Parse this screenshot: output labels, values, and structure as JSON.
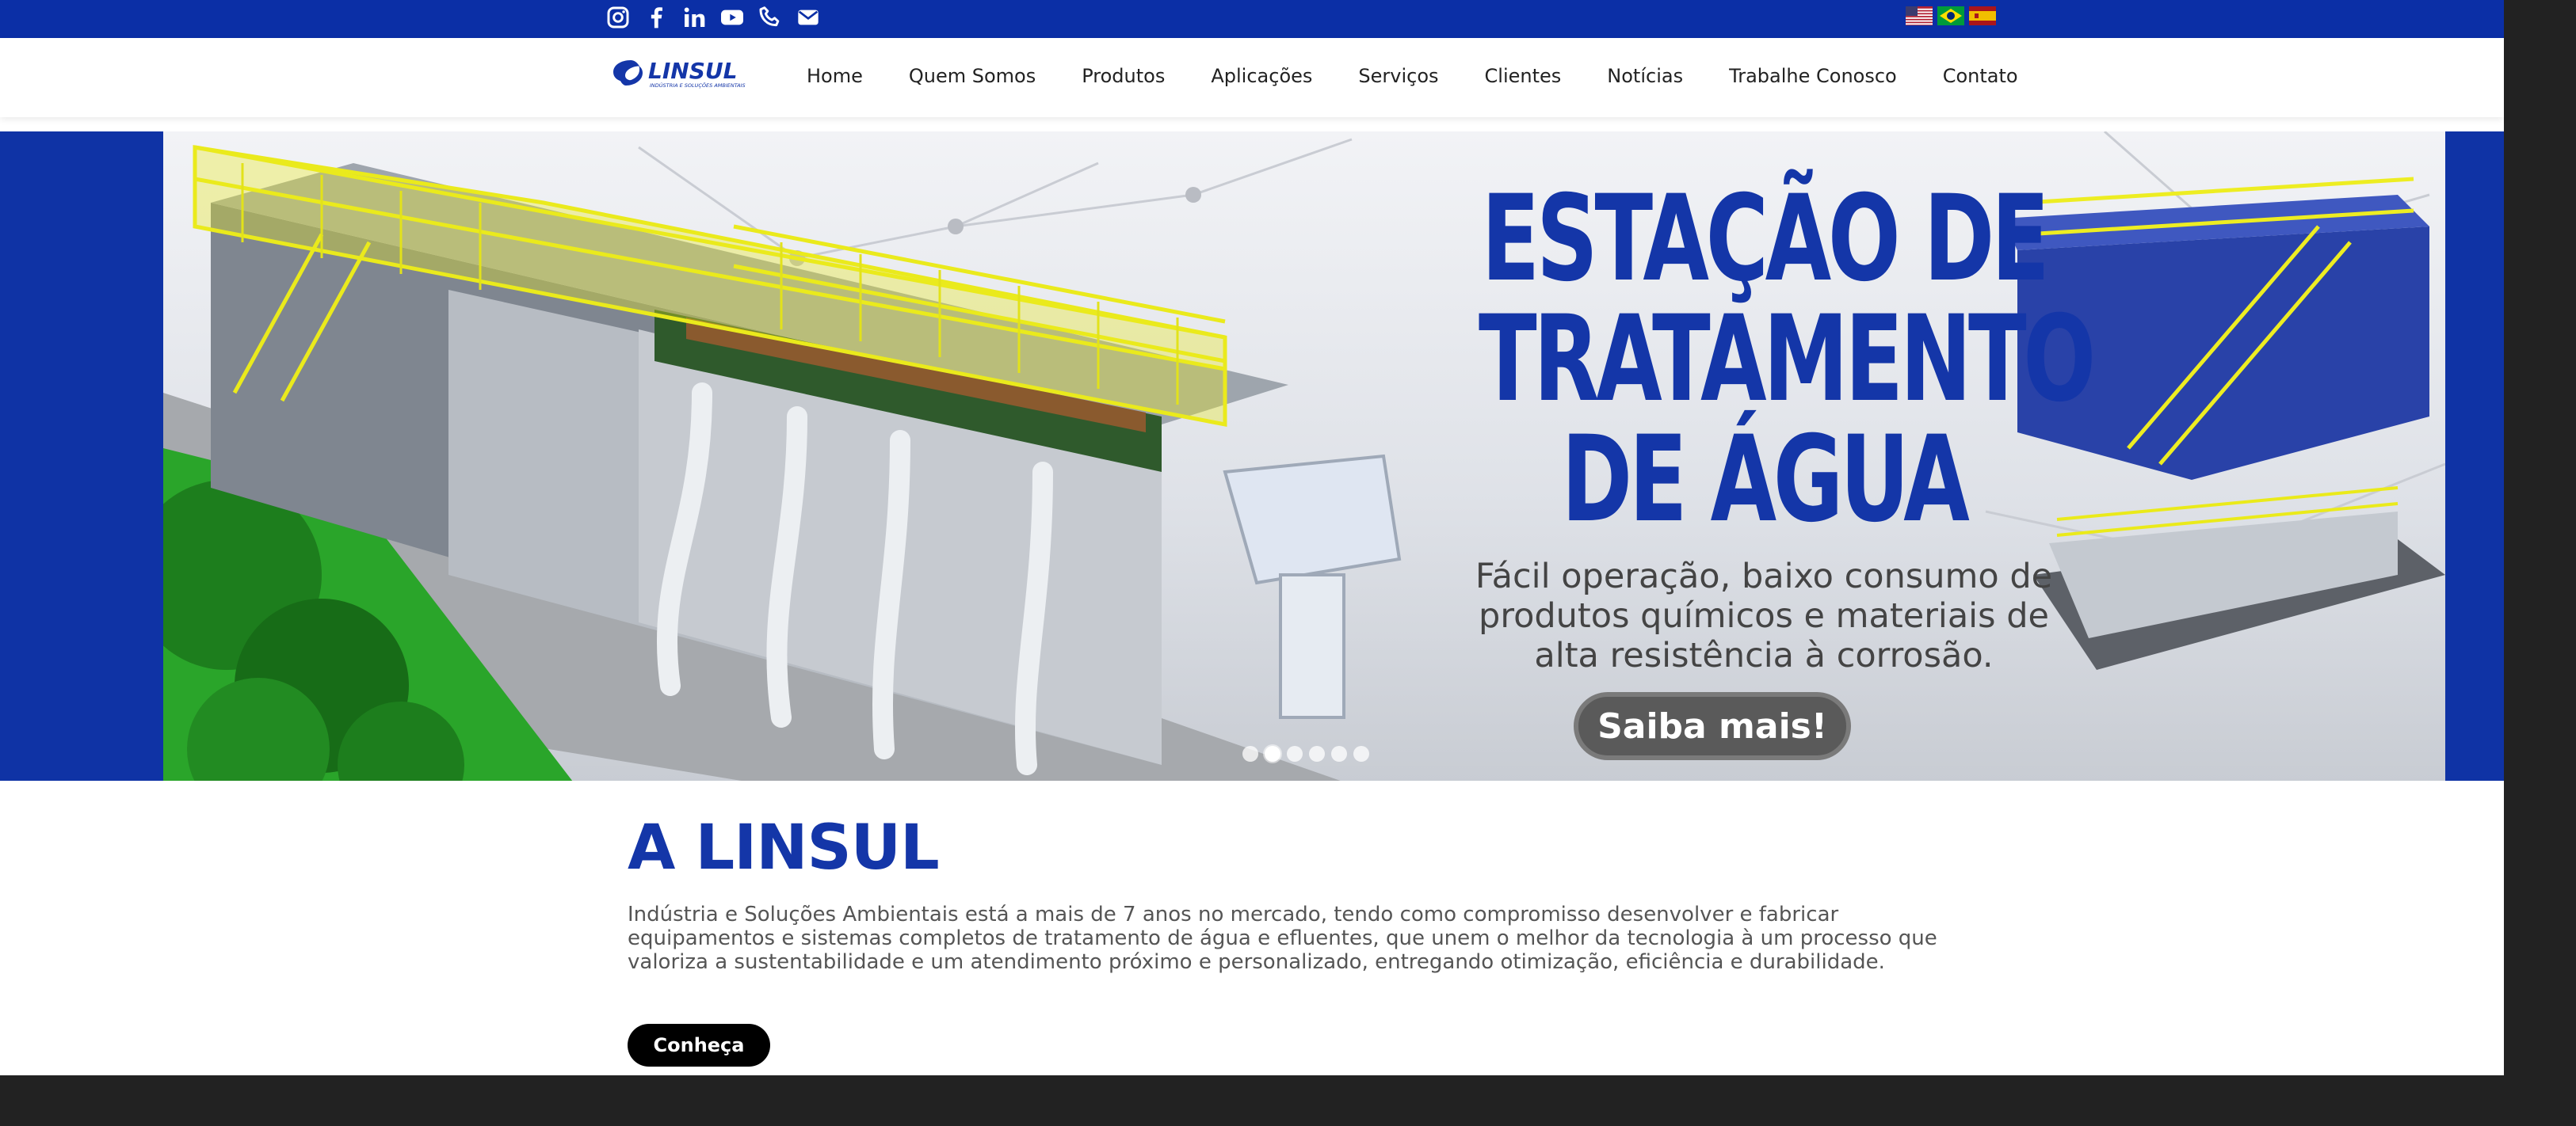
{
  "topbar": {
    "social_icons": [
      "instagram-icon",
      "facebook-icon",
      "linkedin-icon",
      "youtube-icon",
      "phone-icon",
      "mail-icon"
    ],
    "language_flags": [
      "us-flag-icon",
      "brazil-flag-icon",
      "spain-flag-icon"
    ],
    "background_color": "#0b2fa6"
  },
  "header": {
    "logo_text": "LINSUL",
    "logo_tagline": "INDÚSTRIA E SOLUÇÕES AMBIENTAIS",
    "nav": [
      "Home",
      "Quem Somos",
      "Produtos",
      "Aplicações",
      "Serviços",
      "Clientes",
      "Notícias",
      "Trabalhe Conosco",
      "Contato"
    ]
  },
  "hero": {
    "title_lines": [
      "ESTAÇÃO DE",
      "TRATAMENTO",
      "DE ÁGUA"
    ],
    "subtitle_lines": [
      "Fácil operação, baixo consumo de",
      "produtos químicos e materiais de",
      "alta resistência à corrosão."
    ],
    "cta": "Saiba mais!",
    "slides_count": 6,
    "active_slide": 2,
    "accent_color": "#1436a8"
  },
  "about": {
    "title": "A LINSUL",
    "text": "Indústria e Soluções Ambientais está a mais de 7 anos no mercado, tendo como compromisso desenvolver e fabricar equipamentos e sistemas completos de tratamento de água e efluentes, que unem o melhor da tecnologia à um processo que valoriza a sustentabilidade e um atendimento próximo e personalizado, entregando otimização, eficiência e durabilidade.",
    "button": "Conheça"
  }
}
